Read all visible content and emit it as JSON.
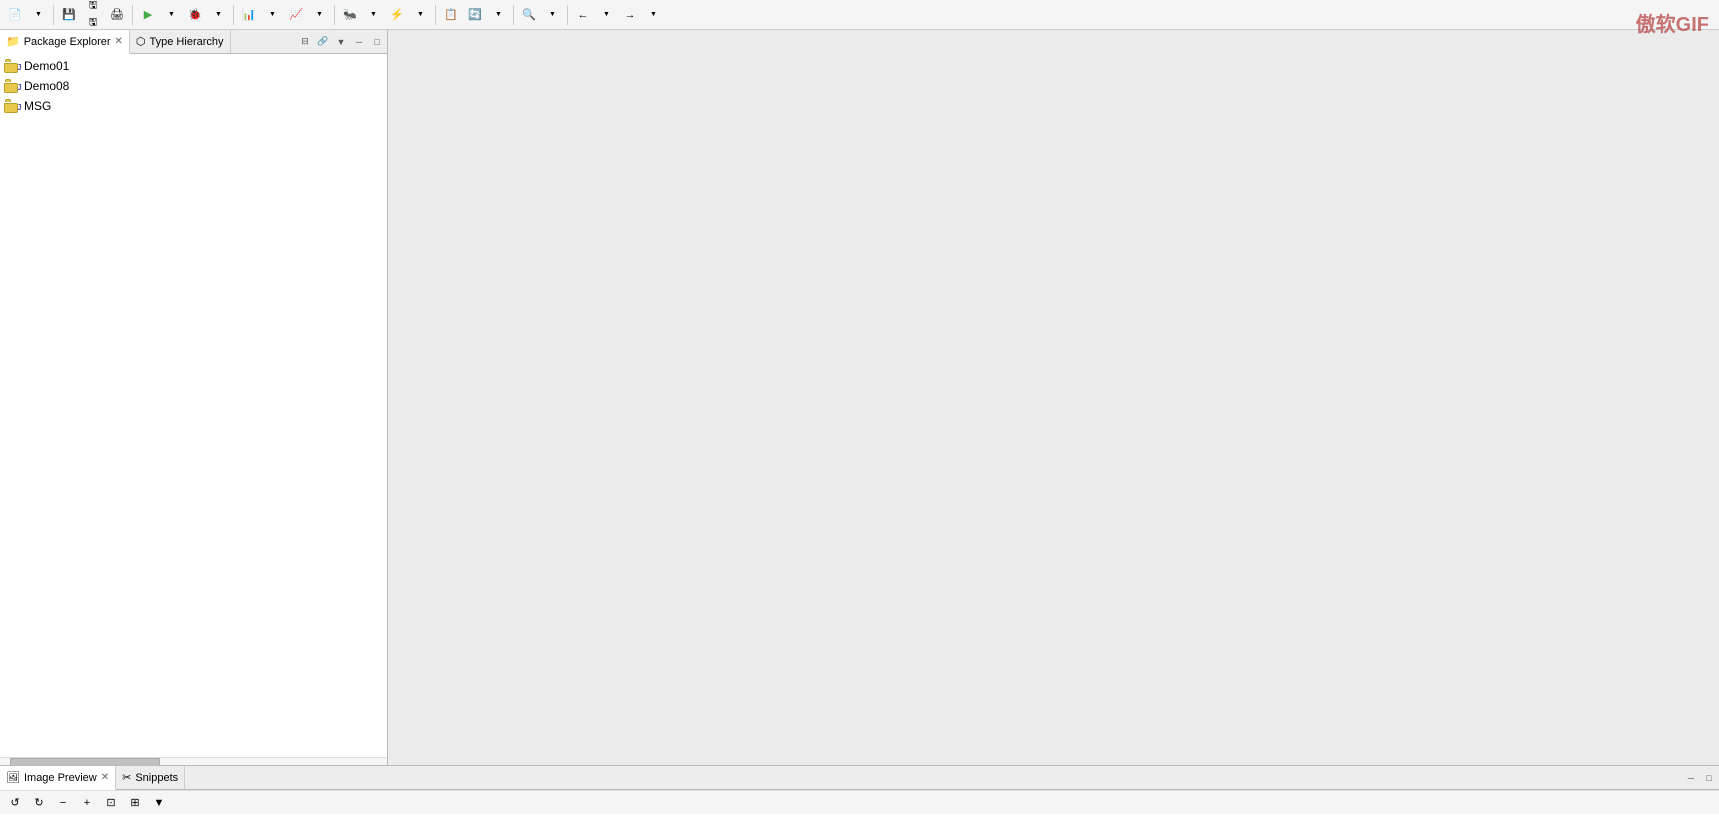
{
  "watermark": "傲软GIF",
  "toolbar": {
    "buttons": [
      {
        "name": "new-btn",
        "label": "▤▼",
        "has_dropdown": true
      },
      {
        "name": "save-btn",
        "label": "💾",
        "has_dropdown": false
      },
      {
        "name": "save-all-btn",
        "label": "🖫",
        "has_dropdown": false
      },
      {
        "name": "print-btn",
        "label": "🖨",
        "has_dropdown": false
      },
      {
        "name": "sep1",
        "type": "separator"
      },
      {
        "name": "run-btn",
        "label": "▶▼",
        "has_dropdown": true
      },
      {
        "name": "debug-btn",
        "label": "🐞▼",
        "has_dropdown": true
      },
      {
        "name": "sep2",
        "type": "separator"
      },
      {
        "name": "profile-btn",
        "label": "📊▼",
        "has_dropdown": true
      },
      {
        "name": "coverage-btn",
        "label": "📈▼",
        "has_dropdown": true
      }
    ]
  },
  "left_panel": {
    "tabs": [
      {
        "id": "package-explorer",
        "label": "Package Explorer",
        "active": true,
        "has_close": true
      },
      {
        "id": "type-hierarchy",
        "label": "Type Hierarchy",
        "active": false,
        "has_close": false
      }
    ],
    "tab_controls": [
      "collapse-all",
      "link-with-editor",
      "view-menu",
      "minimize",
      "maximize"
    ],
    "tree_items": [
      {
        "id": "demo01",
        "label": "Demo01",
        "level": 0
      },
      {
        "id": "demo08",
        "label": "Demo08",
        "level": 0
      },
      {
        "id": "msg",
        "label": "MSG",
        "level": 0
      }
    ]
  },
  "bottom_panel": {
    "tabs": [
      {
        "id": "image-preview",
        "label": "Image Preview",
        "active": true,
        "has_close": true
      },
      {
        "id": "snippets",
        "label": "Snippets",
        "active": false,
        "has_close": false
      }
    ],
    "toolbar_buttons": [
      {
        "name": "rotate-left",
        "label": "↺"
      },
      {
        "name": "rotate-right",
        "label": "↻"
      },
      {
        "name": "zoom-out",
        "label": "−"
      },
      {
        "name": "zoom-in",
        "label": "+"
      },
      {
        "name": "fit-page",
        "label": "⊡"
      },
      {
        "name": "actual-size",
        "label": "⊞"
      },
      {
        "name": "more",
        "label": "▼"
      }
    ]
  }
}
